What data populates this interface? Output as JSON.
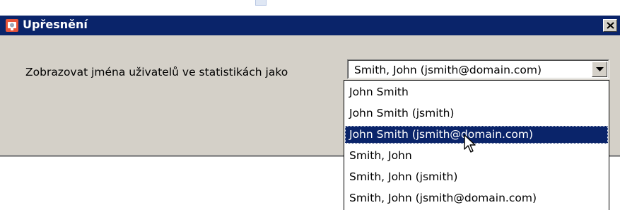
{
  "dialog": {
    "title": "Upřesnění",
    "icon": "app-icon",
    "close_icon": "close-icon"
  },
  "setting": {
    "label": "Zobrazovat jména uživatelů ve statistikách jako",
    "selected_value": "Smith, John (jsmith@domain.com)"
  },
  "dropdown": {
    "options": [
      "John Smith",
      "John Smith (jsmith)",
      "John Smith (jsmith@domain.com)",
      "Smith, John",
      "Smith, John (jsmith)",
      "Smith, John (jsmith@domain.com)"
    ],
    "highlighted_index": 2
  },
  "colors": {
    "titlebar": "#0a246a",
    "dialog_bg": "#d4d0c8",
    "highlight": "#0a246a"
  }
}
